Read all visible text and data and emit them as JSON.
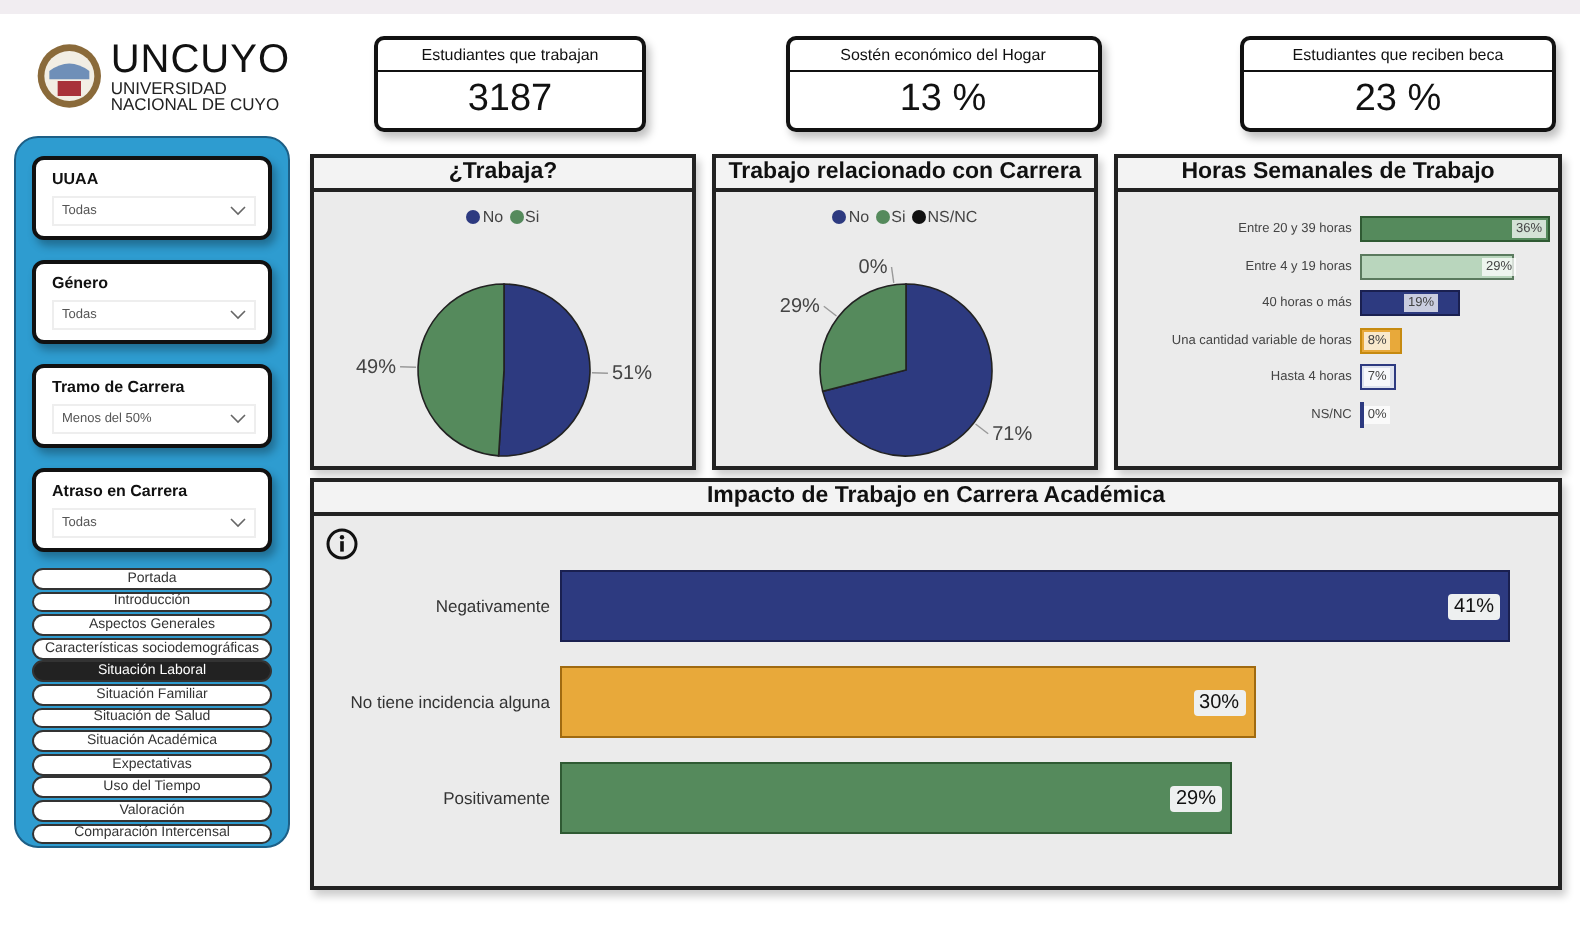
{
  "logo": {
    "name": "UNCUYO",
    "subtitle_1": "UNIVERSIDAD",
    "subtitle_2": "NACIONAL DE CUYO"
  },
  "kpis": [
    {
      "label": "Estudiantes que trabajan",
      "value": "3187"
    },
    {
      "label": "Sostén económico del Hogar",
      "value": "13 %"
    },
    {
      "label": "Estudiantes que reciben beca",
      "value": "23 %"
    }
  ],
  "filters": [
    {
      "label": "UUAA",
      "value": "Todas"
    },
    {
      "label": "Género",
      "value": "Todas"
    },
    {
      "label": "Tramo de Carrera",
      "value": "Menos del 50%"
    },
    {
      "label": "Atraso en Carrera",
      "value": "Todas"
    }
  ],
  "nav": [
    {
      "label": "Portada",
      "selected": false
    },
    {
      "label": "Introducción",
      "selected": false
    },
    {
      "label": "Aspectos Generales",
      "selected": false
    },
    {
      "label": "Características sociodemográficas",
      "selected": false
    },
    {
      "label": "Situación Laboral",
      "selected": true
    },
    {
      "label": "Situación Familiar",
      "selected": false
    },
    {
      "label": "Situación de Salud",
      "selected": false
    },
    {
      "label": "Situación Académica",
      "selected": false
    },
    {
      "label": "Expectativas",
      "selected": false
    },
    {
      "label": "Uso del Tiempo",
      "selected": false
    },
    {
      "label": "Valoración",
      "selected": false
    },
    {
      "label": "Comparación Intercensal",
      "selected": false
    }
  ],
  "pies": [
    {
      "chart_data": {
        "type": "pie",
        "title": "¿Trabaja?",
        "legend": "top",
        "categories": [
          "No",
          "Si"
        ],
        "values": [
          51,
          49
        ],
        "data_labels": true,
        "value_labels": [
          "51%",
          "49%"
        ]
      }
    },
    {
      "chart_data": {
        "type": "pie",
        "title": "Trabajo relacionado con Carrera",
        "legend": "top",
        "categories": [
          "No",
          "Si",
          "NS/NC"
        ],
        "values": [
          71,
          29,
          0
        ],
        "data_labels": true,
        "value_labels": [
          "71%",
          "29%",
          "0%"
        ]
      }
    }
  ],
  "hours": {
    "chart_data": {
      "type": "bar",
      "orientation": "horizontal",
      "title": "Horas Semanales de Trabajo",
      "categories": [
        "Entre 20 y 39 horas",
        "Entre 4 y 19 horas",
        "40 horas o más",
        "Una cantidad variable de horas",
        "Hasta 4 horas",
        "NS/NC"
      ],
      "values": [
        36,
        29,
        19,
        8,
        7,
        0
      ],
      "data_labels": true,
      "value_labels": [
        "36%",
        "29%",
        "19%",
        "8%",
        "7%",
        "0%"
      ]
    }
  },
  "impact": {
    "chart_data": {
      "type": "bar",
      "orientation": "horizontal",
      "title": "Impacto de Trabajo en Carrera Académica",
      "categories": [
        "Negativamente",
        "No tiene incidencia alguna",
        "Positivamente"
      ],
      "values": [
        41,
        30,
        29
      ],
      "data_labels": true,
      "value_labels": [
        "41%",
        "30%",
        "29%"
      ]
    }
  }
}
